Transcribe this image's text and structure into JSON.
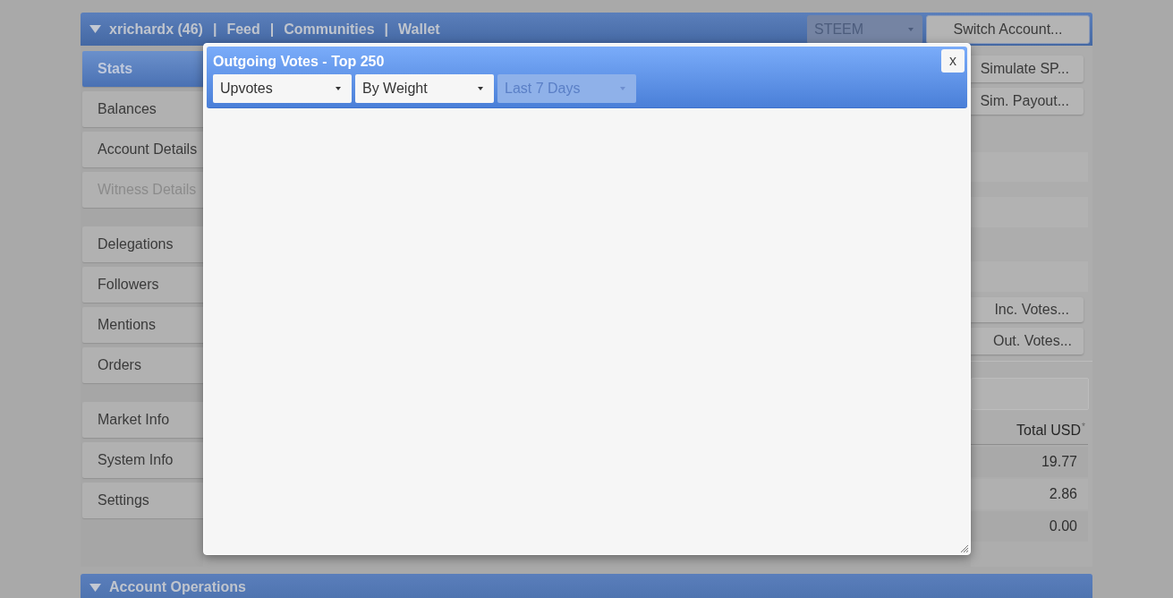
{
  "header": {
    "expanded": true,
    "account": "xrichardx (46)",
    "links": [
      {
        "separator": "|",
        "label": "Feed"
      },
      {
        "separator": "|",
        "label": "Communities"
      },
      {
        "separator": "|",
        "label": "Wallet"
      }
    ],
    "currency_select": {
      "value": "STEEM",
      "disabled": true
    },
    "switch_button": "Switch Account..."
  },
  "sidebar": {
    "groups": [
      [
        {
          "label": "Stats",
          "selected": true,
          "disabled": false
        },
        {
          "label": "Balances",
          "selected": false,
          "disabled": false
        },
        {
          "label": "Account Details",
          "selected": false,
          "disabled": false
        },
        {
          "label": "Witness Details",
          "selected": false,
          "disabled": true
        }
      ],
      [
        {
          "label": "Delegations",
          "selected": false,
          "disabled": false
        },
        {
          "label": "Followers",
          "selected": false,
          "disabled": false
        },
        {
          "label": "Mentions",
          "selected": false,
          "disabled": false
        },
        {
          "label": "Orders",
          "selected": false,
          "disabled": false
        }
      ],
      [
        {
          "label": "Market Info",
          "selected": false,
          "disabled": false
        },
        {
          "label": "System Info",
          "selected": false,
          "disabled": false
        },
        {
          "label": "Settings",
          "selected": false,
          "disabled": false
        }
      ]
    ]
  },
  "side_panel": {
    "buttons": [
      "Simulate SP...",
      "Sim. Payout..."
    ],
    "vote_buttons": [
      "Inc. Votes...",
      "Out. Votes..."
    ],
    "table": {
      "columns": [
        "Total USD$^{*}$"
      ],
      "rows": [
        [
          "19.77"
        ],
        [
          "2.86"
        ],
        [
          "0.00"
        ]
      ]
    }
  },
  "account_operations": {
    "title": "Account Operations",
    "expanded": true
  },
  "modal": {
    "title": "Outgoing Votes - Top 250",
    "close": "x",
    "filters": [
      {
        "value": "Upvotes",
        "disabled": false
      },
      {
        "value": "By Weight",
        "disabled": false
      },
      {
        "value": "Last 7 Days",
        "disabled": true
      }
    ]
  }
}
